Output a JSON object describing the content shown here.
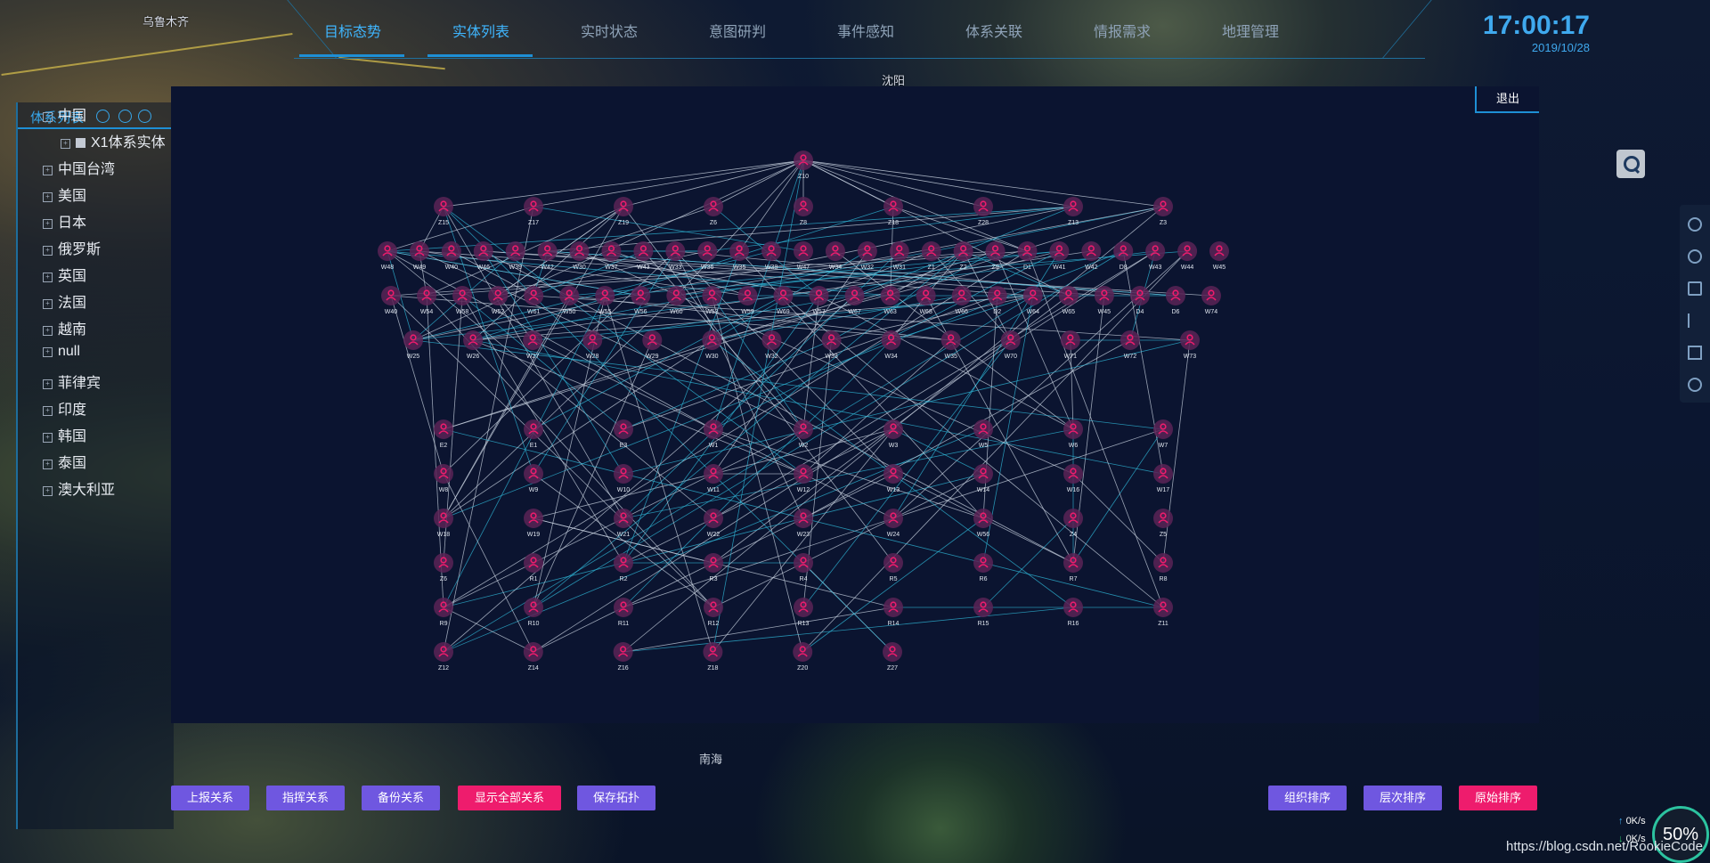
{
  "map_labels": {
    "city": "乌鲁木齐",
    "shenyang": "沈阳",
    "nanhai": "南海"
  },
  "nav": {
    "tabs": [
      "目标态势",
      "实体列表",
      "实时状态",
      "意图研判",
      "事件感知",
      "体系关联",
      "情报需求",
      "地理管理"
    ],
    "active_index": 1
  },
  "clock": {
    "time": "17:00:17",
    "date": "2019/10/28"
  },
  "sidebar": {
    "title": "体系列表",
    "items": [
      {
        "label": "中国",
        "expanded": true
      },
      {
        "label": "X1体系实体",
        "child": true
      },
      {
        "label": "中国台湾"
      },
      {
        "label": "美国"
      },
      {
        "label": "日本"
      },
      {
        "label": "俄罗斯"
      },
      {
        "label": "英国"
      },
      {
        "label": "法国"
      },
      {
        "label": "越南"
      },
      {
        "label": "null"
      },
      {
        "label": "菲律宾"
      },
      {
        "label": "印度"
      },
      {
        "label": "韩国"
      },
      {
        "label": "泰国"
      },
      {
        "label": "澳大利亚"
      }
    ]
  },
  "graph": {
    "exit_label": "退出",
    "rows": [
      [
        "Z10"
      ],
      [
        "Z15",
        "Z17",
        "Z19",
        "Z6",
        "Z8",
        "Z18",
        "Z28",
        "Z13",
        "Z3"
      ],
      [
        "W48",
        "W49",
        "W40",
        "W46",
        "W39",
        "W42",
        "W30",
        "W37",
        "W43",
        "W33",
        "W36",
        "W35",
        "W38",
        "W47",
        "W34",
        "W32",
        "W31",
        "Z1",
        "Z2",
        "Z9",
        "D1",
        "W41",
        "W42",
        "D8",
        "W43",
        "W44",
        "W45"
      ],
      [
        "W40",
        "W54",
        "W58",
        "W52",
        "W61",
        "W50",
        "W55",
        "W56",
        "W60",
        "W53",
        "W59",
        "W69",
        "W57",
        "W67",
        "W63",
        "W68",
        "W66",
        "D2",
        "W64",
        "W65",
        "W45",
        "D4",
        "D6",
        "W74"
      ],
      [
        "W25",
        "W26",
        "W27",
        "W28",
        "W29",
        "W30",
        "W32",
        "W33",
        "W34",
        "W35",
        "W70",
        "W71",
        "W72",
        "W73"
      ],
      [
        "E2",
        "E1",
        "E3",
        "W1",
        "W2",
        "W3",
        "W5",
        "W6",
        "W7"
      ],
      [
        "W8",
        "W9",
        "W10",
        "W11",
        "W12",
        "W13",
        "W14",
        "W16",
        "W17"
      ],
      [
        "W18",
        "W19",
        "W21",
        "W22",
        "W23",
        "W24",
        "W56",
        "Z4",
        "Z5"
      ],
      [
        "Z6",
        "R1",
        "R2",
        "R3",
        "R4",
        "R5",
        "R6",
        "R7",
        "R8"
      ],
      [
        "R9",
        "R10",
        "R11",
        "R12",
        "R13",
        "R14",
        "R15",
        "R16",
        "Z11"
      ],
      [
        "Z12",
        "Z14",
        "Z16",
        "Z18",
        "Z20",
        "Z27"
      ]
    ]
  },
  "buttons": {
    "left": [
      {
        "label": "上报关系",
        "style": "purple"
      },
      {
        "label": "指挥关系",
        "style": "purple"
      },
      {
        "label": "备份关系",
        "style": "purple"
      },
      {
        "label": "显示全部关系",
        "style": "pink"
      },
      {
        "label": "保存拓扑",
        "style": "purple"
      }
    ],
    "right": [
      {
        "label": "组织排序",
        "style": "purple"
      },
      {
        "label": "层次排序",
        "style": "purple"
      },
      {
        "label": "原始排序",
        "style": "pink"
      }
    ]
  },
  "status": {
    "up": "0K/s",
    "down": "0K/s",
    "gauge": "50%"
  },
  "watermark": "https://blog.csdn.net/RookieCode",
  "colors": {
    "accent": "#3fb6ff",
    "node": "#ee1c6d",
    "link_cyan": "#2fb8d8",
    "link_white": "#c8d2e0",
    "btn_purple": "#6f57e0",
    "btn_pink": "#ee1c6d"
  }
}
